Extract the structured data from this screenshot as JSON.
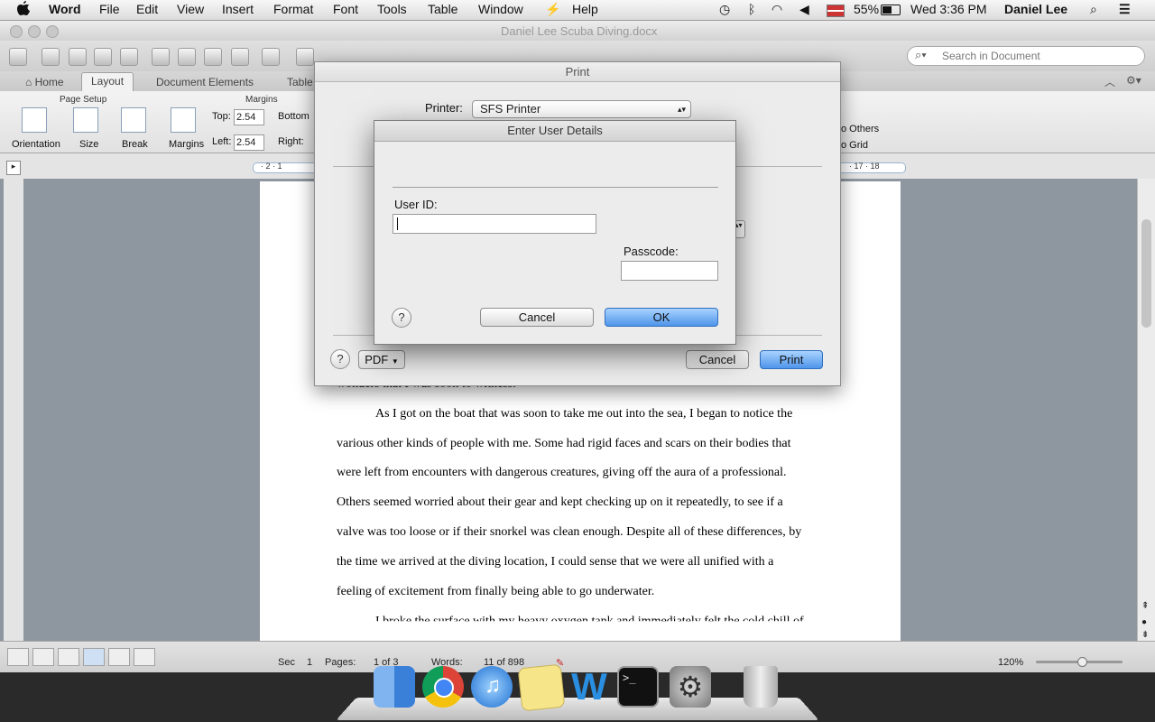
{
  "menubar": {
    "app": "Word",
    "items": [
      "File",
      "Edit",
      "View",
      "Insert",
      "Format",
      "Font",
      "Tools",
      "Table",
      "Window",
      "Help"
    ],
    "battery": "55%",
    "clock": "Wed 3:36 PM",
    "user": "Daniel Lee"
  },
  "window": {
    "title": "Daniel Lee Scuba Diving.docx",
    "search_placeholder": "Search in Document"
  },
  "tabs": [
    "Home",
    "Layout",
    "Document Elements",
    "Table"
  ],
  "ribbon": {
    "group_page_setup": "Page Setup",
    "group_margins": "Margins",
    "orientation": "Orientation",
    "size": "Size",
    "break": "Break",
    "margins": "Margins",
    "top_label": "Top:",
    "top_value": "2.54",
    "bottom_label": "Bottom",
    "left_label": "Left:",
    "left_value": "2.54",
    "right_label": "Right:",
    "others_label": "o Others",
    "grid_label": "o Grid"
  },
  "ruler": {
    "left_ticks": "· 2 · 1",
    "right_ticks": "· 17 · 18"
  },
  "document": {
    "lines": [
      "wonders that I was soon to witness.",
      "As I got on the boat that was soon to take me out into the sea, I began to notice the",
      "various other kinds of people with me. Some had rigid faces and scars on their bodies that",
      "were left from encounters with dangerous creatures, giving off the aura of a professional.",
      "Others seemed worried about their gear and kept checking up on it repeatedly, to see if a",
      "valve was too loose or if their snorkel was clean enough. Despite all of these differences, by",
      "the time we arrived at the diving location, I could sense that we were all unified with a",
      "feeling of excitement from finally being able to go underwater.",
      "I broke the surface with my heavy oxygen tank and immediately felt the cold chill of"
    ]
  },
  "status": {
    "sec_label": "Sec",
    "sec_value": "1",
    "pages_label": "Pages:",
    "pages_value": "1 of 3",
    "words_label": "Words:",
    "words_value": "11 of 898",
    "zoom": "120%"
  },
  "print_dialog": {
    "title": "Print",
    "printer_label": "Printer:",
    "printer_value": "SFS Printer",
    "help": "?",
    "pdf": "PDF",
    "cancel": "Cancel",
    "print": "Print"
  },
  "user_dialog": {
    "title": "Enter User Details",
    "user_id_label": "User ID:",
    "user_id_value": "",
    "passcode_label": "Passcode:",
    "passcode_value": "",
    "help": "?",
    "cancel": "Cancel",
    "ok": "OK"
  },
  "dock": [
    "Finder",
    "Chrome",
    "iTunes",
    "Stickies",
    "Word",
    "Terminal",
    "System Preferences",
    "Trash"
  ]
}
